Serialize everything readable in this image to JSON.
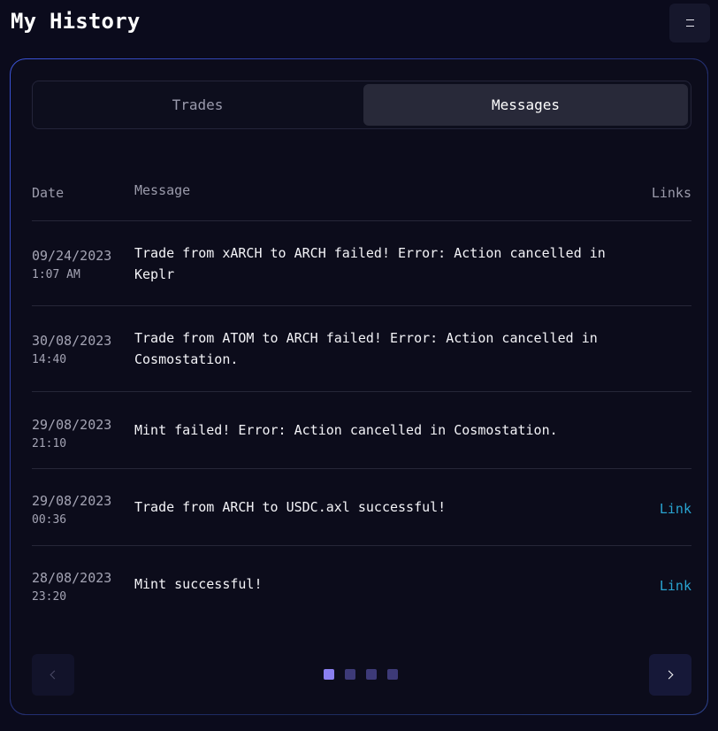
{
  "header": {
    "title": "My History",
    "menu_icon": "hamburger-menu-icon"
  },
  "tabs": [
    {
      "label": "Trades",
      "active": false
    },
    {
      "label": "Messages",
      "active": true
    }
  ],
  "table": {
    "columns": {
      "date": "Date",
      "message": "Message",
      "links": "Links"
    },
    "rows": [
      {
        "date": "09/24/2023",
        "time": "1:07 AM",
        "message": "Trade from xARCH to ARCH failed! Error: Action cancelled in Keplr",
        "link": ""
      },
      {
        "date": "30/08/2023",
        "time": "14:40",
        "message": "Trade from ATOM to ARCH failed! Error: Action cancelled in Cosmostation.",
        "link": ""
      },
      {
        "date": "29/08/2023",
        "time": "21:10",
        "message": "Mint failed! Error: Action cancelled in Cosmostation.",
        "link": ""
      },
      {
        "date": "29/08/2023",
        "time": "00:36",
        "message": "Trade from ARCH to USDC.axl successful!",
        "link": "Link"
      },
      {
        "date": "28/08/2023",
        "time": "23:20",
        "message": "Mint successful!",
        "link": "Link"
      }
    ]
  },
  "pagination": {
    "pages": 4,
    "current": 1,
    "prev_icon": "chevron-left-icon",
    "next_icon": "chevron-right-icon"
  },
  "colors": {
    "background": "#0b0b1c",
    "card_border": "#2f3a78",
    "active_tab": "#282939",
    "link": "#29a5d2",
    "dot_active": "#8a7ff0",
    "dot_inactive": "#3d3a78"
  }
}
